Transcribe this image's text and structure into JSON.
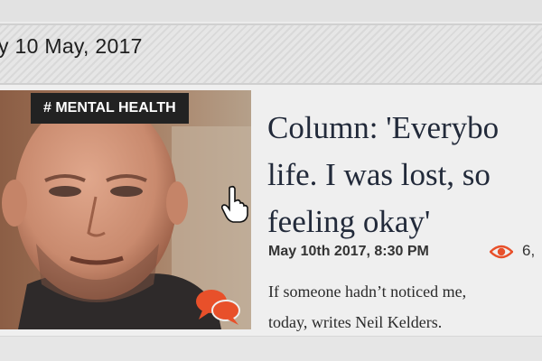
{
  "date_heading": "y 10 May, 2017",
  "article": {
    "tag": "# MENTAL HEALTH",
    "title_lines": [
      "Column: 'Everybo",
      "life. I was lost, so",
      "feeling okay'"
    ],
    "meta": "May 10th 2017, 8:30 PM",
    "views": "6,",
    "excerpt_lines": [
      "If someone hadn’t noticed me,",
      "today, writes Neil Kelders."
    ]
  },
  "icons": {
    "views": "eye-icon",
    "comments": "comments-icon",
    "cursor": "hand-pointer-icon"
  },
  "colors": {
    "tag_background": "#222222",
    "accent": "#e8502a",
    "title": "#222a3a"
  }
}
